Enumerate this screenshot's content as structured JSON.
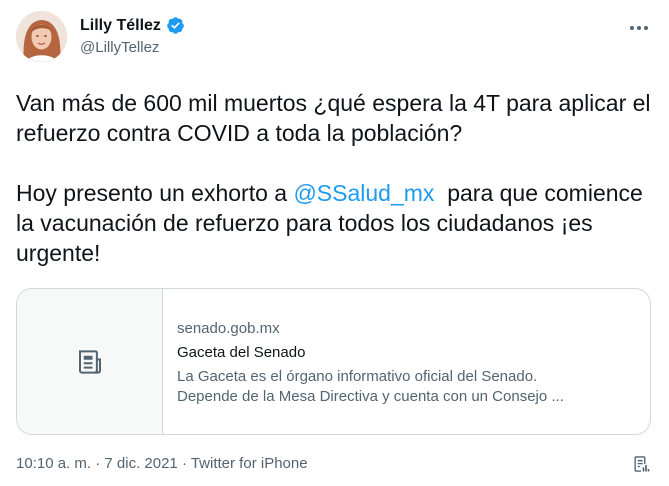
{
  "author": {
    "display_name": "Lilly Téllez",
    "handle": "@LillyTellez",
    "verified": true
  },
  "tweet": {
    "paragraph1": "Van más de 600 mil muertos ¿qué espera la 4T para aplicar el refuerzo contra COVID a toda la población?",
    "paragraph2_before": "Hoy presento un exhorto a ",
    "mention": "@SSalud_mx",
    "paragraph2_after": "  para que comience la vacunación de refuerzo para todos los ciudadanos ¡es urgente!"
  },
  "card": {
    "domain": "senado.gob.mx",
    "title": "Gaceta del Senado",
    "description_line1": "La Gaceta es el órgano informativo oficial del Senado.",
    "description_line2": "Depende de la Mesa Directiva y cuenta con un Consejo ..."
  },
  "meta": {
    "time": "10:10 a. m.",
    "separator1": " · ",
    "date": "7 dic. 2021",
    "separator2": " · ",
    "source": "Twitter for iPhone"
  },
  "colors": {
    "accent": "#1d9bf0",
    "text": "#0f1419",
    "secondary": "#536471",
    "border": "#cfd9de"
  },
  "icons": {
    "more": "more-horizontal-icon",
    "verified": "verified-badge-icon",
    "card": "article-icon",
    "analytics": "analytics-icon"
  }
}
